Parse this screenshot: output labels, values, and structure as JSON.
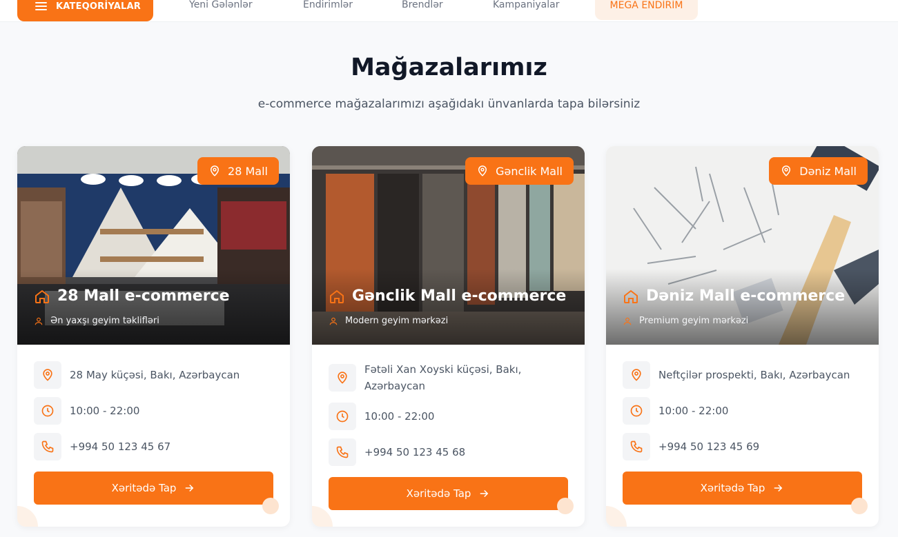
{
  "nav": {
    "categories_label": "KATEQORİYALAR",
    "links": [
      "Yeni Gələnlər",
      "Endirimlər",
      "Brendlər",
      "Kampaniyalar"
    ],
    "mega_label": "MEGA ENDİRİM"
  },
  "header": {
    "title": "Mağazalarımız",
    "subtitle": "e-commerce mağazalarımızı aşağıdakı ünvanlarda tapa bilərsiniz"
  },
  "stores": [
    {
      "badge": "28 Mall",
      "title": "28 Mall e-commerce",
      "subtitle": "Ən yaxşı geyim təklifləri",
      "address": "28 May küçəsi, Bakı, Azərbaycan",
      "hours": "10:00 - 22:00",
      "phone": "+994 50 123 45 67",
      "map_label": "Xəritədə Tap"
    },
    {
      "badge": "Gənclik Mall",
      "title": "Gənclik Mall e-commerce",
      "subtitle": "Modern geyim mərkəzi",
      "address": "Fətəli Xan Xoyski küçəsi, Bakı, Azərbaycan",
      "hours": "10:00 - 22:00",
      "phone": "+994 50 123 45 68",
      "map_label": "Xəritədə Tap"
    },
    {
      "badge": "Dəniz Mall",
      "title": "Dəniz Mall e-commerce",
      "subtitle": "Premium geyim mərkəzi",
      "address": "Neftçilər prospekti, Bakı, Azərbaycan",
      "hours": "10:00 - 22:00",
      "phone": "+994 50 123 45 69",
      "map_label": "Xəritədə Tap"
    }
  ],
  "icons": {
    "menu": "menu-icon",
    "badge": "map-pin-icon",
    "title": "home-icon",
    "subtitle": "user-icon",
    "address": "map-pin-icon",
    "hours": "clock-icon",
    "phone": "phone-icon",
    "map_button": "arrow-right-icon"
  },
  "colors": {
    "accent": "#f97316",
    "accent_soft": "#fdf0e6",
    "background": "#f8f9fb"
  }
}
